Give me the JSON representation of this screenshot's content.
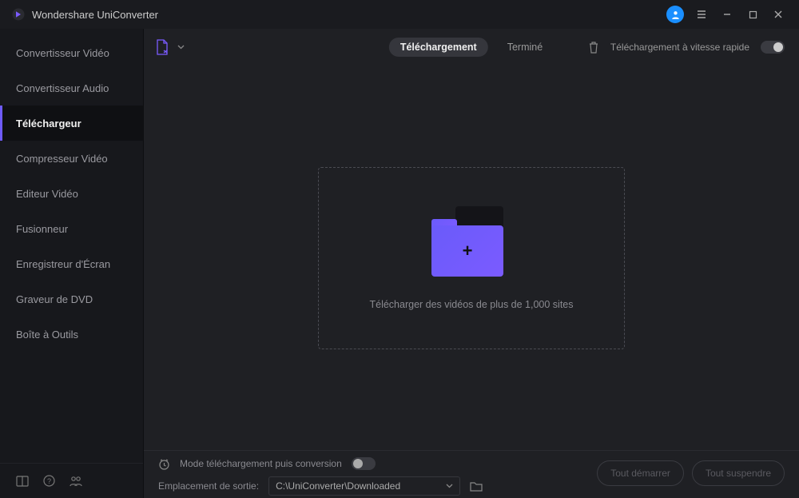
{
  "app": {
    "title": "Wondershare UniConverter"
  },
  "sidebar": {
    "items": [
      {
        "label": "Convertisseur Vidéo"
      },
      {
        "label": "Convertisseur Audio"
      },
      {
        "label": "Téléchargeur"
      },
      {
        "label": "Compresseur Vidéo"
      },
      {
        "label": "Editeur Vidéo"
      },
      {
        "label": "Fusionneur"
      },
      {
        "label": "Enregistreur d'Écran"
      },
      {
        "label": "Graveur de DVD"
      },
      {
        "label": "Boîte à Outils"
      }
    ],
    "active_index": 2
  },
  "toolbar": {
    "tabs": [
      {
        "label": "Téléchargement"
      },
      {
        "label": "Terminé"
      }
    ],
    "active_tab": 0,
    "fast_download_label": "Téléchargement à vitesse rapide"
  },
  "dropzone": {
    "text": "Télécharger des vidéos de plus de 1,000 sites"
  },
  "footer": {
    "convert_mode_label": "Mode téléchargement puis conversion",
    "output_label": "Emplacement de sortie:",
    "output_path": "C:\\UniConverter\\Downloaded",
    "start_all": "Tout démarrer",
    "pause_all": "Tout suspendre"
  }
}
